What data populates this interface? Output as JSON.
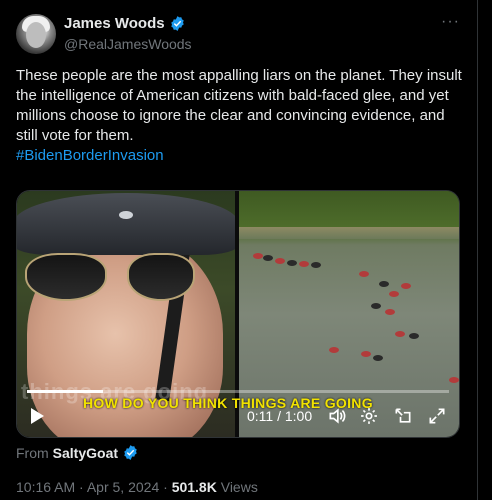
{
  "author": {
    "display_name": "James Woods",
    "handle": "@RealJamesWoods"
  },
  "more_icon": "more-horizontal-icon",
  "tweet": {
    "text": "These people are the most appalling liars on the planet. They insult the intelligence of American citizens with bald-faced glee, and yet millions choose to ignore the clear and convincing evidence, and still vote for them.",
    "hashtag": "#BidenBorderInvasion"
  },
  "video": {
    "caption_ghost": "things are going",
    "caption": "HOW DO YOU THINK THINGS ARE GOING",
    "time": "0:11 / 1:00",
    "progress": 0.18
  },
  "source": {
    "prefix": "From",
    "name": "SaltyGoat"
  },
  "meta": {
    "time": "10:16 AM",
    "date": "Apr 5, 2024",
    "views_count": "501.8K",
    "views_label": "Views",
    "separator": "·"
  },
  "colors": {
    "verified": "#1d9bf0",
    "caption": "#f2e300",
    "link": "#1d9bf0"
  }
}
